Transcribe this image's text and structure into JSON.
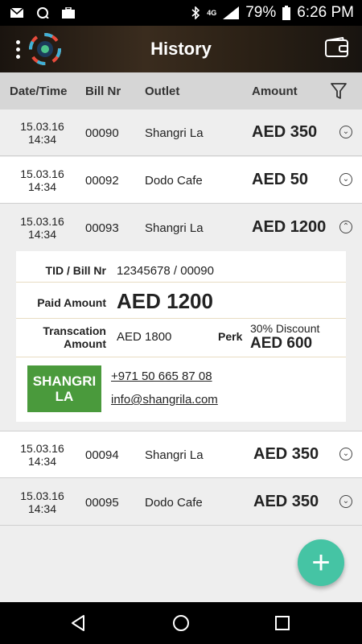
{
  "status": {
    "battery": "79%",
    "time": "6:26 PM",
    "network": "4G"
  },
  "header": {
    "title": "History"
  },
  "columns": {
    "date": "Date/Time",
    "bill": "Bill Nr",
    "outlet": "Outlet",
    "amount": "Amount"
  },
  "rows": [
    {
      "date": "15.03.16",
      "time": "14:34",
      "bill": "00090",
      "outlet": "Shangri La",
      "amount": "AED 350",
      "expanded": false
    },
    {
      "date": "15.03.16",
      "time": "14:34",
      "bill": "00092",
      "outlet": "Dodo Cafe",
      "amount": "AED 50",
      "expanded": false
    },
    {
      "date": "15.03.16",
      "time": "14:34",
      "bill": "00093",
      "outlet": "Shangri La",
      "amount": "AED 1200",
      "expanded": true
    },
    {
      "date": "15.03.16",
      "time": "14:34",
      "bill": "00094",
      "outlet": "Shangri La",
      "amount": "AED 350",
      "expanded": false
    },
    {
      "date": "15.03.16",
      "time": "14:34",
      "bill": "00095",
      "outlet": "Dodo Cafe",
      "amount": "AED 350",
      "expanded": false
    }
  ],
  "detail": {
    "tid_label": "TID / Bill Nr",
    "tid_value": "12345678 / 00090",
    "paid_label": "Paid Amount",
    "paid_value": "AED 1200",
    "txn_label_1": "Transcation",
    "txn_label_2": "Amount",
    "txn_value": "AED 1800",
    "perk_label": "Perk",
    "perk_desc": "30% Discount",
    "perk_value": "AED 600",
    "brand_line1": "SHANGRI",
    "brand_line2": "LA",
    "phone": "+971 50 665 87 08",
    "email": "info@shangrila.com"
  },
  "fab": {
    "label": "+"
  },
  "colors": {
    "accent": "#45c4a4",
    "brand": "#4a9a3c"
  }
}
